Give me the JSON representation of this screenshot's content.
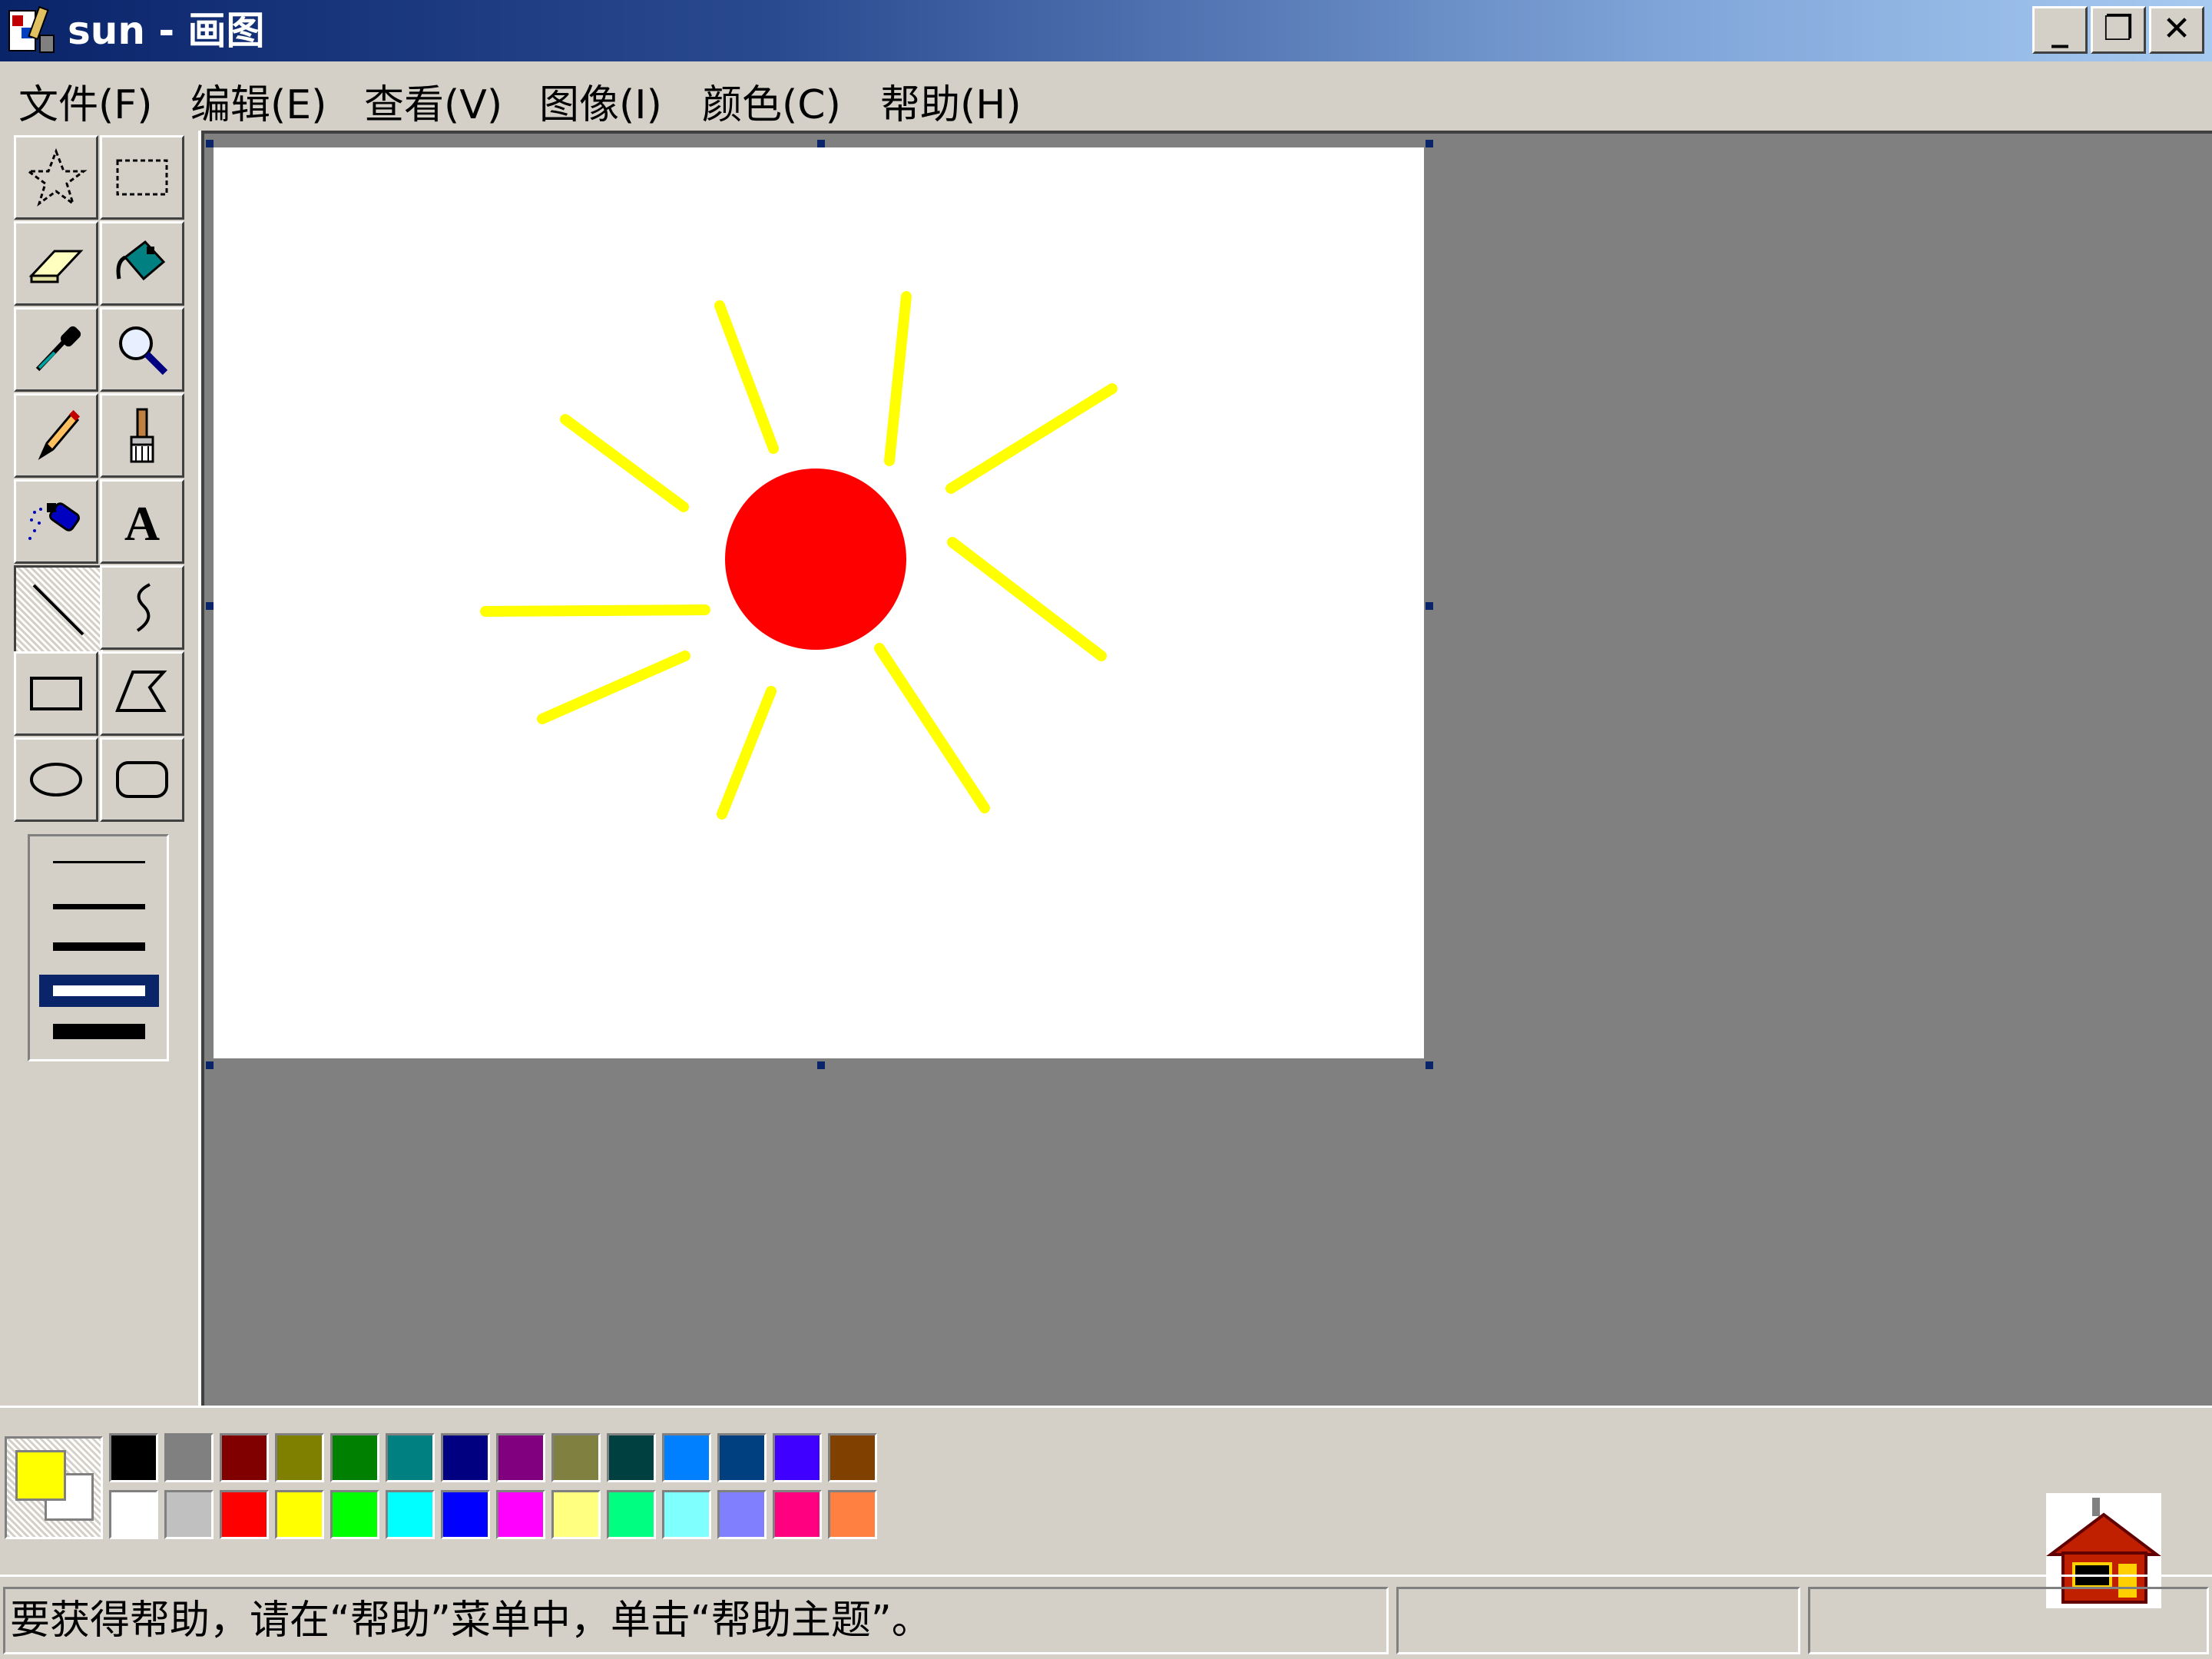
{
  "window": {
    "title": "sun - 画图",
    "buttons": {
      "minimize": "_",
      "restore": "❐",
      "close": "✕"
    }
  },
  "menu": [
    {
      "label": "文件(F)"
    },
    {
      "label": "编辑(E)"
    },
    {
      "label": "查看(V)"
    },
    {
      "label": "图像(I)"
    },
    {
      "label": "颜色(C)"
    },
    {
      "label": "帮助(H)"
    }
  ],
  "tools": [
    {
      "name": "free-form-select",
      "icon": "star-select-icon"
    },
    {
      "name": "select",
      "icon": "rect-select-icon"
    },
    {
      "name": "eraser",
      "icon": "eraser-icon"
    },
    {
      "name": "fill-with-color",
      "icon": "paint-bucket-icon"
    },
    {
      "name": "pick-color",
      "icon": "eyedropper-icon"
    },
    {
      "name": "magnifier",
      "icon": "magnifier-icon"
    },
    {
      "name": "pencil",
      "icon": "pencil-icon"
    },
    {
      "name": "brush",
      "icon": "brush-icon"
    },
    {
      "name": "airbrush",
      "icon": "airbrush-icon"
    },
    {
      "name": "text",
      "icon": "text-icon"
    },
    {
      "name": "line",
      "icon": "line-icon",
      "selected": true
    },
    {
      "name": "curve",
      "icon": "curve-icon"
    },
    {
      "name": "rectangle",
      "icon": "rectangle-icon"
    },
    {
      "name": "polygon",
      "icon": "polygon-icon"
    },
    {
      "name": "ellipse",
      "icon": "ellipse-icon"
    },
    {
      "name": "rounded-rectangle",
      "icon": "rounded-rect-icon"
    }
  ],
  "line_widths": {
    "count": 5,
    "selected_index": 3
  },
  "drawing": {
    "sun_color": "#ff0000",
    "ray_color": "#ffff00",
    "background": "#ffffff"
  },
  "colors": {
    "foreground": "#ffff00",
    "background": "#ffffff",
    "palette_top": [
      "#000000",
      "#808080",
      "#800000",
      "#808000",
      "#008000",
      "#008080",
      "#000080",
      "#800080",
      "#808040",
      "#004040",
      "#0080ff",
      "#004080",
      "#4000ff",
      "#804000"
    ],
    "palette_bottom": [
      "#ffffff",
      "#c0c0c0",
      "#ff0000",
      "#ffff00",
      "#00ff00",
      "#00ffff",
      "#0000ff",
      "#ff00ff",
      "#ffff80",
      "#00ff80",
      "#80ffff",
      "#8080ff",
      "#ff0080",
      "#ff8040"
    ]
  },
  "status": {
    "message": "要获得帮助，请在“帮助”菜单中，单击“帮助主题”。"
  }
}
